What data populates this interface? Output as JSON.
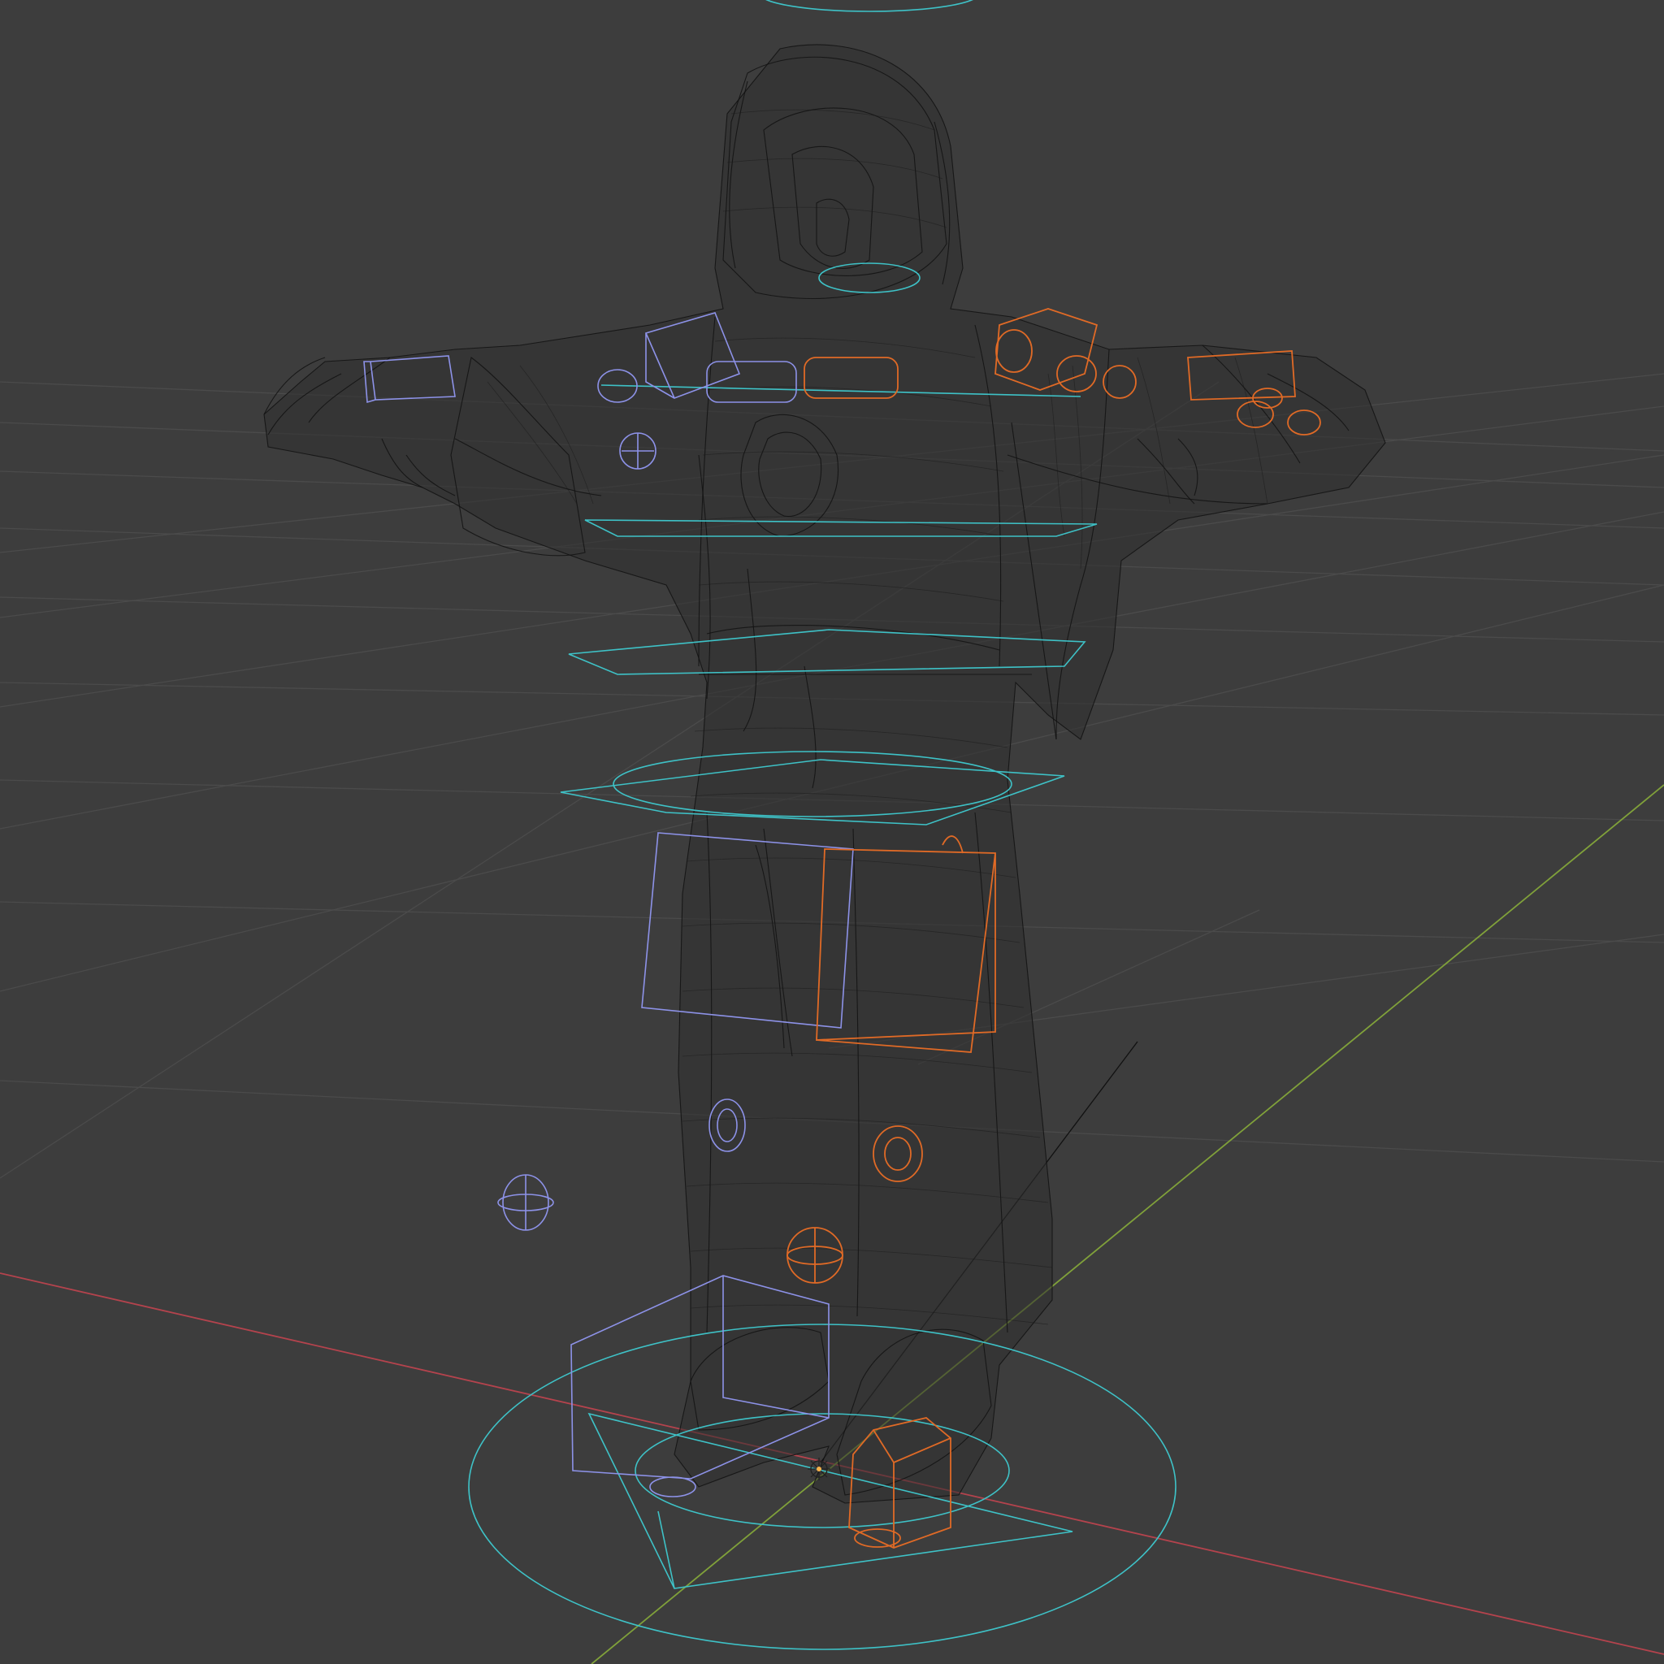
{
  "app": {
    "view_mode": "wireframe",
    "object_type": "armature-rig-with-mesh"
  },
  "colors": {
    "background": "#3d3d3d",
    "grid": "#4b4b4b",
    "x_axis": "#b4434d",
    "y_axis": "#80a13a",
    "mesh_wire": "#121212",
    "control_cyan": "#3ec2c7",
    "control_blue": "#8d92e8",
    "control_orange": "#e06a26",
    "origin": "#f5b14a"
  },
  "icons": {
    "origin_marker": "origin-crosshair-icon",
    "light_empty": "sphere-empty-icon"
  }
}
